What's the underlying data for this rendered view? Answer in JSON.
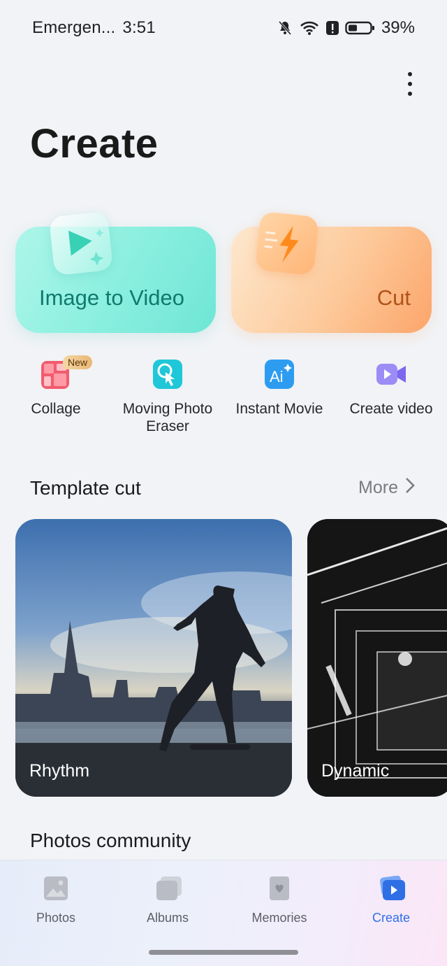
{
  "status_bar": {
    "carrier": "Emergen...",
    "time": "3:51",
    "battery": "39%",
    "icons": [
      "bell-muted-icon",
      "wifi-icon",
      "alert-icon",
      "battery-icon"
    ]
  },
  "page": {
    "title": "Create"
  },
  "feature_cards": [
    {
      "label": "Image to Video",
      "icon": "play-sparkle-icon"
    },
    {
      "label": "Cut",
      "icon": "lightning-icon"
    }
  ],
  "tools": [
    {
      "label": "Collage",
      "icon": "collage-icon",
      "badge": "New"
    },
    {
      "label": "Moving Photo Eraser",
      "icon": "touch-eraser-icon"
    },
    {
      "label": "Instant Movie",
      "icon": "ai-icon"
    },
    {
      "label": "Create video",
      "icon": "video-camera-icon"
    }
  ],
  "template_section": {
    "title": "Template cut",
    "more": "More",
    "items": [
      {
        "label": "Rhythm"
      },
      {
        "label": "Dynamic"
      }
    ]
  },
  "community_section": {
    "title": "Photos community"
  },
  "bottom_nav": {
    "active": "Create",
    "items": [
      {
        "label": "Photos",
        "icon": "photo-icon"
      },
      {
        "label": "Albums",
        "icon": "albums-icon"
      },
      {
        "label": "Memories",
        "icon": "memories-icon"
      },
      {
        "label": "Create",
        "icon": "create-icon"
      }
    ]
  },
  "colors": {
    "accent": "#2f6fe5",
    "i2v_text": "#0f7a6d",
    "cut_text": "#b05317"
  }
}
